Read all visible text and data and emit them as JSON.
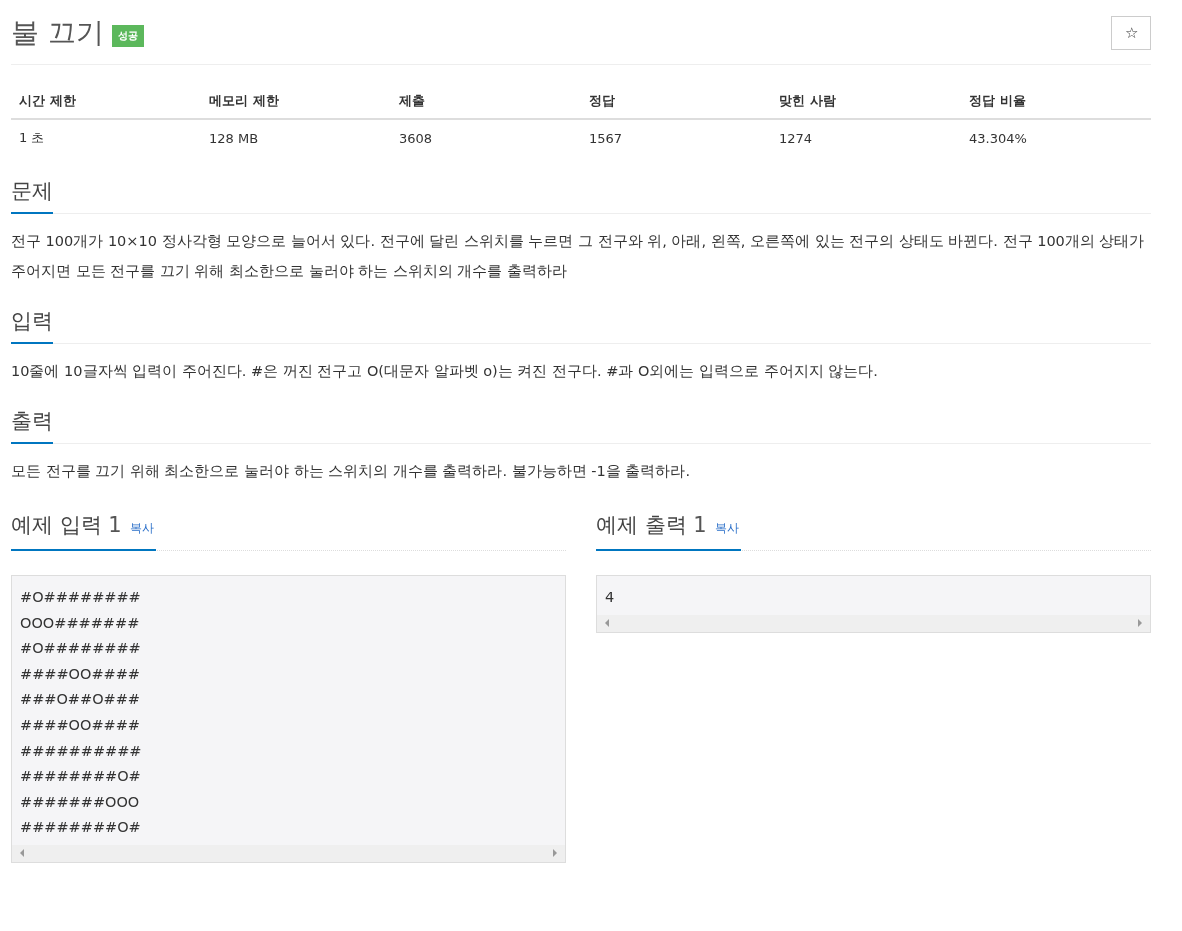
{
  "title": "불 끄기",
  "badge": "성공",
  "star_button": "☆",
  "stats": {
    "columns": [
      "시간 제한",
      "메모리 제한",
      "제출",
      "정답",
      "맞힌 사람",
      "정답 비율"
    ],
    "row": [
      "1 초",
      "128 MB",
      "3608",
      "1567",
      "1274",
      "43.304%"
    ]
  },
  "sections": [
    {
      "heading": "문제",
      "text": "전구 100개가 10×10 정사각형 모양으로 늘어서 있다. 전구에 달린 스위치를 누르면 그 전구와 위, 아래, 왼쪽, 오른쪽에 있는 전구의 상태도 바뀐다. 전구 100개의 상태가 주어지면 모든 전구를 끄기 위해 최소한으로 눌러야 하는 스위치의 개수를 출력하라"
    },
    {
      "heading": "입력",
      "text": "10줄에 10글자씩 입력이 주어진다. #은 꺼진 전구고 O(대문자 알파벳 o)는 켜진 전구다. #과 O외에는 입력으로 주어지지 않는다."
    },
    {
      "heading": "출력",
      "text": "모든 전구를 끄기 위해 최소한으로 눌러야 하는 스위치의 개수를 출력하라. 불가능하면 -1을 출력하라."
    }
  ],
  "examples": [
    {
      "title": "예제 입력",
      "number": "1",
      "copy": "복사",
      "lines": [
        "#O########",
        "OOO#######",
        "#O########",
        "####OO####",
        "###O##O###",
        "####OO####",
        "##########",
        "########O#",
        "#######OOO",
        "########O#"
      ]
    },
    {
      "title": "예제 출력",
      "number": "1",
      "copy": "복사",
      "lines": [
        "4"
      ]
    }
  ]
}
